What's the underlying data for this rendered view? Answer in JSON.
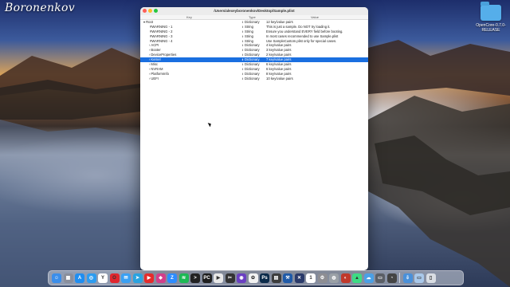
{
  "desktop": {
    "watermark": "Boronenkov",
    "folder_label_line1": "OpenCore-0.7.0-",
    "folder_label_line2": "RELEASE"
  },
  "window": {
    "title": "/Users/alexeyboronenkov/Desktop/Sample.plist",
    "columns": {
      "key": "Key",
      "type": "Type",
      "value": "Value"
    },
    "rows": [
      {
        "key": "Root",
        "type": "Dictionary",
        "value": "12 key/value pairs",
        "indent": 0,
        "disclosure": "▾"
      },
      {
        "key": "#WARNING - 1",
        "type": "String",
        "value": "This is just a sample. Do NOT try loading it.",
        "indent": 1,
        "disclosure": ""
      },
      {
        "key": "#WARNING - 2",
        "type": "String",
        "value": "Ensure you understand EVERY field before booting.",
        "indent": 1,
        "disclosure": ""
      },
      {
        "key": "#WARNING - 3",
        "type": "String",
        "value": "In most cases recommended to use Sample.plist",
        "indent": 1,
        "disclosure": ""
      },
      {
        "key": "#WARNING - 4",
        "type": "String",
        "value": "Use SampleCustom.plist only for special cases.",
        "indent": 1,
        "disclosure": ""
      },
      {
        "key": "ACPI",
        "type": "Dictionary",
        "value": "4 key/value pairs",
        "indent": 1,
        "disclosure": "›"
      },
      {
        "key": "Booter",
        "type": "Dictionary",
        "value": "3 key/value pairs",
        "indent": 1,
        "disclosure": "›"
      },
      {
        "key": "DeviceProperties",
        "type": "Dictionary",
        "value": "2 key/value pairs",
        "indent": 1,
        "disclosure": "›"
      },
      {
        "key": "Kernel",
        "type": "Dictionary",
        "value": "7 key/value pairs",
        "indent": 1,
        "disclosure": "›",
        "selected": true
      },
      {
        "key": "Misc",
        "type": "Dictionary",
        "value": "6 key/value pairs",
        "indent": 1,
        "disclosure": "›"
      },
      {
        "key": "NVRAM",
        "type": "Dictionary",
        "value": "6 key/value pairs",
        "indent": 1,
        "disclosure": "›"
      },
      {
        "key": "PlatformInfo",
        "type": "Dictionary",
        "value": "8 key/value pairs",
        "indent": 1,
        "disclosure": "›"
      },
      {
        "key": "UEFI",
        "type": "Dictionary",
        "value": "10 key/value pairs",
        "indent": 1,
        "disclosure": "›"
      }
    ],
    "type_stepper": "⬍"
  },
  "dock": {
    "apps": [
      {
        "name": "finder-icon",
        "glyph": "☺",
        "color": "#3b8eea"
      },
      {
        "name": "launchpad-icon",
        "glyph": "▦",
        "color": "#8a8f9c"
      },
      {
        "name": "app-store-icon",
        "glyph": "A",
        "color": "#1f8ef1"
      },
      {
        "name": "safari-icon",
        "glyph": "◎",
        "color": "#2d9cf0"
      },
      {
        "name": "yandex-browser-icon",
        "glyph": "Y",
        "color": "#ffffff"
      },
      {
        "name": "opera-icon",
        "glyph": "O",
        "color": "#e0262f"
      },
      {
        "name": "mail-icon",
        "glyph": "✉",
        "color": "#3aa0f3"
      },
      {
        "name": "telegram-icon",
        "glyph": "➤",
        "color": "#2aa3e0"
      },
      {
        "name": "youtube-icon",
        "glyph": "▶",
        "color": "#e52b2b"
      },
      {
        "name": "messenger-icon",
        "glyph": "◆",
        "color": "#d33f8a"
      },
      {
        "name": "zoom-icon",
        "glyph": "Z",
        "color": "#2d8cff"
      },
      {
        "name": "spotify-icon",
        "glyph": "≋",
        "color": "#1db954"
      },
      {
        "name": "terminal-icon",
        "glyph": ">",
        "color": "#222222"
      },
      {
        "name": "pycharm-icon",
        "glyph": "PC",
        "color": "#1f1f1f"
      },
      {
        "name": "media-player-icon",
        "glyph": "▶",
        "color": "#e8e8e8"
      },
      {
        "name": "final-cut-icon",
        "glyph": "✂",
        "color": "#333333"
      },
      {
        "name": "video-app-icon",
        "glyph": "◉",
        "color": "#6a3fc2"
      },
      {
        "name": "photos-icon",
        "glyph": "✿",
        "color": "#f2f2f2"
      },
      {
        "name": "photoshop-icon",
        "glyph": "Ps",
        "color": "#0b2b4a"
      },
      {
        "name": "system-tool-icon",
        "glyph": "▤",
        "color": "#3c3c3c"
      },
      {
        "name": "xcode-icon",
        "glyph": "⚒",
        "color": "#1f5aa8"
      },
      {
        "name": "network-tool-icon",
        "glyph": "✕",
        "color": "#2a3a6a"
      },
      {
        "name": "calendar-icon",
        "glyph": "1",
        "color": "#ffffff"
      },
      {
        "name": "system-preferences-icon",
        "glyph": "⚙",
        "color": "#8e8e93"
      },
      {
        "name": "disk-utility-icon",
        "glyph": "◍",
        "color": "#9aa0a6"
      },
      {
        "name": "utility-icon",
        "glyph": "◐",
        "color": "#c0392b"
      },
      {
        "name": "android-icon",
        "glyph": "▲",
        "color": "#3ddc84"
      },
      {
        "name": "cloud-icon",
        "glyph": "☁",
        "color": "#4aa0e6"
      },
      {
        "name": "monitor-icon",
        "glyph": "▭",
        "color": "#5b5f66"
      },
      {
        "name": "activity-monitor-icon",
        "glyph": "◔",
        "color": "#444444"
      }
    ],
    "stacks": [
      {
        "name": "downloads-stack-icon",
        "glyph": "⇩",
        "color": "#4a90d9"
      },
      {
        "name": "folder-stack-icon",
        "glyph": "▭",
        "color": "#a9c8ea"
      },
      {
        "name": "trash-icon",
        "glyph": "▯",
        "color": "#d9dde3"
      }
    ]
  }
}
